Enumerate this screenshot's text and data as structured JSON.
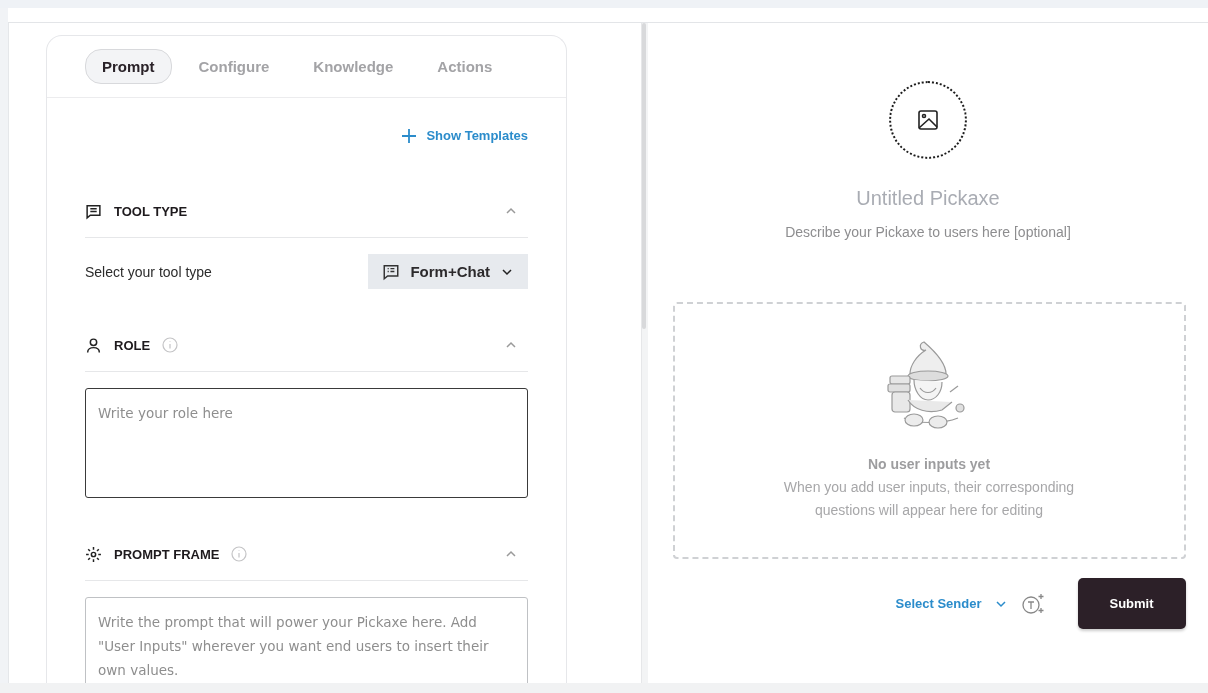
{
  "tabs": [
    {
      "label": "Prompt",
      "selected": true
    },
    {
      "label": "Configure",
      "selected": false
    },
    {
      "label": "Knowledge",
      "selected": false
    },
    {
      "label": "Actions",
      "selected": false
    }
  ],
  "show_templates": "Show Templates",
  "sections": [
    {
      "kind": "select",
      "title": "TOOL TYPE",
      "info": false,
      "expanded": true,
      "label": "Select your tool type",
      "value": "Form+Chat"
    },
    {
      "kind": "textarea",
      "title": "ROLE",
      "info": true,
      "expanded": true,
      "placeholder": "Write your role here"
    },
    {
      "kind": "textarea",
      "title": "PROMPT FRAME",
      "info": true,
      "expanded": true,
      "placeholder": "Write the prompt that will power your Pickaxe here. Add \"User Inputs\" wherever you want end users to insert their own values."
    }
  ],
  "preview": {
    "title": "Untitled Pickaxe",
    "description": "Describe your Pickaxe to users here [optional]",
    "empty_title": "No user inputs yet",
    "empty_text": "When you add user inputs, their corresponding questions will appear here for editing",
    "sender": "Select Sender",
    "submit": "Submit"
  }
}
